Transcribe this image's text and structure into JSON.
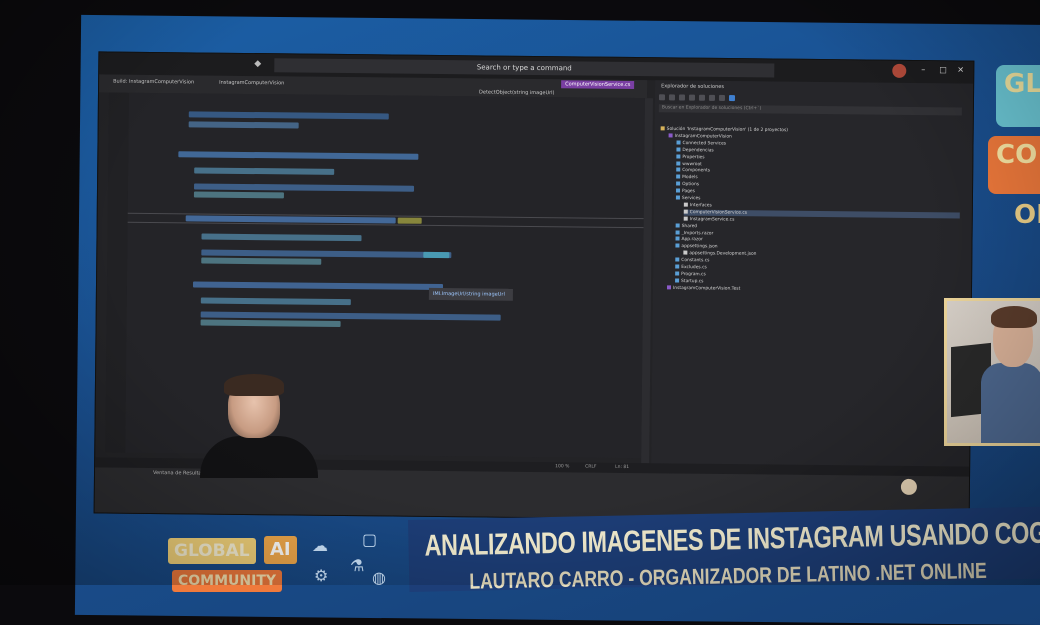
{
  "ide": {
    "search_placeholder": "Search or type a command",
    "window_title": "Build: InstagramComputerVision",
    "tabs": [
      {
        "label": "InstagramComputerVision",
        "active": false
      },
      {
        "label": "ComputerVisionService.cs",
        "active": true
      },
      {
        "label": "DetectObject(string imageUrl)",
        "active": false
      }
    ],
    "tooltip": "IMI.ImageUrl/string imageUrl"
  },
  "solution": {
    "header": "Explorador de soluciones",
    "search_placeholder": "Buscar en Explorador de soluciones (Ctrl+`)",
    "items": [
      {
        "label": "Solución 'InstagramComputerVision' (1 de 2 proyectos)",
        "indent": 0
      },
      {
        "label": "InstagramComputerVision",
        "indent": 1
      },
      {
        "label": "Connected Services",
        "indent": 2
      },
      {
        "label": "Dependencias",
        "indent": 2
      },
      {
        "label": "Properties",
        "indent": 2
      },
      {
        "label": "wwwroot",
        "indent": 2
      },
      {
        "label": "Components",
        "indent": 2
      },
      {
        "label": "Models",
        "indent": 2
      },
      {
        "label": "Options",
        "indent": 2
      },
      {
        "label": "Pages",
        "indent": 2
      },
      {
        "label": "Services",
        "indent": 2
      },
      {
        "label": "Interfaces",
        "indent": 3
      },
      {
        "label": "ComputerVisionService.cs",
        "indent": 3,
        "selected": true
      },
      {
        "label": "InstagramService.cs",
        "indent": 3
      },
      {
        "label": "Shared",
        "indent": 2
      },
      {
        "label": "_Imports.razor",
        "indent": 2
      },
      {
        "label": "App.razor",
        "indent": 2
      },
      {
        "label": "appsettings.json",
        "indent": 2
      },
      {
        "label": "appsettings.Development.json",
        "indent": 3
      },
      {
        "label": "Constants.cs",
        "indent": 2
      },
      {
        "label": "Excludes.cs",
        "indent": 2
      },
      {
        "label": "Program.cs",
        "indent": 2
      },
      {
        "label": "Startup.cs",
        "indent": 2
      },
      {
        "label": "InstagramComputerVision.Test",
        "indent": 1
      }
    ]
  },
  "statusbar": {
    "zoom": "100 %",
    "encoding": "CRLF",
    "position": "Ln: 81"
  },
  "output": {
    "label": "Ventana de Resultados"
  },
  "branding": {
    "right_top": "GL",
    "right_mid": "CO",
    "right_bottom": "ON"
  },
  "banner": {
    "logo_global": "GLOBAL",
    "logo_ai": "AI",
    "logo_community": "COMMUNITY",
    "title": "ANALIZANDO IMAGENES DE INSTAGRAM USANDO COGNITIVE SERVICES",
    "subtitle": "LAUTARO CARRO - ORGANIZADOR DE LATINO .NET ONLINE"
  },
  "colors": {
    "background_blue": "#1a4f8f",
    "accent_purple": "#7a3fa3",
    "banner_cream": "#f6f0d2",
    "brand_orange": "#f07a3c",
    "brand_teal": "#6cc8d6"
  }
}
